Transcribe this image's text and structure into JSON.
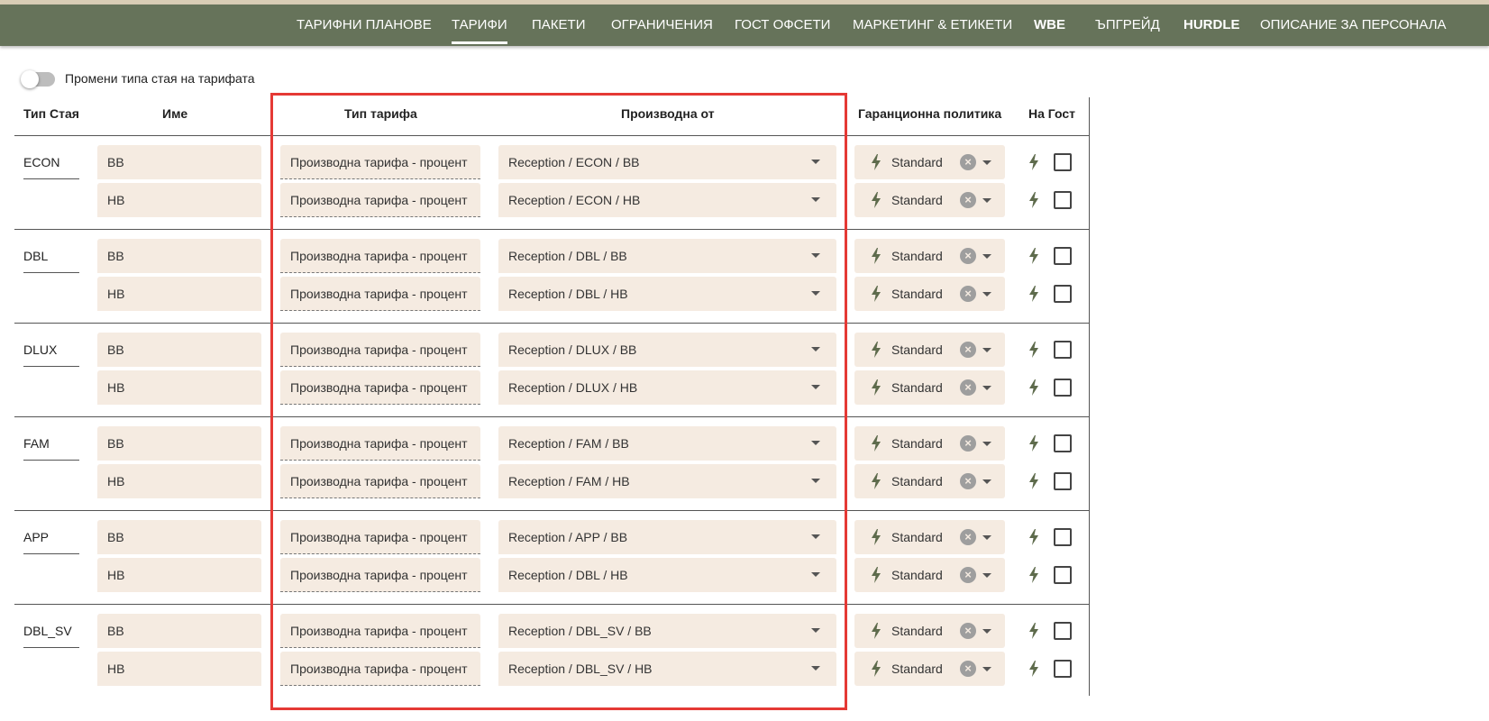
{
  "nav": {
    "items": [
      {
        "label": "ТАРИФНИ ПЛАНОВЕ",
        "bold": false,
        "active": false
      },
      {
        "label": "ТАРИФИ",
        "bold": false,
        "active": true
      },
      {
        "label": "ПАКЕТИ",
        "bold": false,
        "active": false
      },
      {
        "label": "ОГРАНИЧЕНИЯ",
        "bold": false,
        "active": false
      },
      {
        "label": "ГОСТ ОФСЕТИ",
        "bold": false,
        "active": false
      },
      {
        "label": "МАРКЕТИНГ & ЕТИКЕТИ",
        "bold": false,
        "active": false
      },
      {
        "label": "WBE",
        "bold": true,
        "active": false
      },
      {
        "label": "ЪПГРЕЙД",
        "bold": false,
        "active": false
      },
      {
        "label": "HURDLE",
        "bold": true,
        "active": false
      },
      {
        "label": "ОПИСАНИЕ ЗА ПЕРСОНАЛА",
        "bold": false,
        "active": false
      }
    ]
  },
  "toggle": {
    "label": "Промени типа стая на тарифата",
    "on": false
  },
  "headers": {
    "room_type": "Тип Стая",
    "name": "Име",
    "rate_type": "Тип тарифа",
    "derived_from": "Производна от",
    "guarantee": "Гаранционна политика",
    "on_guest": "На Гост"
  },
  "rooms": [
    {
      "code": "ECON",
      "rates": [
        {
          "name": "BB",
          "type": "Производна тарифа - процент",
          "derived": "Reception / ECON / BB",
          "policy": "Standard",
          "guest_checked": false
        },
        {
          "name": "HB",
          "type": "Производна тарифа - процент",
          "derived": "Reception / ECON / HB",
          "policy": "Standard",
          "guest_checked": false
        }
      ]
    },
    {
      "code": "DBL",
      "rates": [
        {
          "name": "BB",
          "type": "Производна тарифа - процент",
          "derived": "Reception / DBL / BB",
          "policy": "Standard",
          "guest_checked": false
        },
        {
          "name": "HB",
          "type": "Производна тарифа - процент",
          "derived": "Reception / DBL / HB",
          "policy": "Standard",
          "guest_checked": false
        }
      ]
    },
    {
      "code": "DLUX",
      "rates": [
        {
          "name": "BB",
          "type": "Производна тарифа - процент",
          "derived": "Reception / DLUX / BB",
          "policy": "Standard",
          "guest_checked": false
        },
        {
          "name": "HB",
          "type": "Производна тарифа - процент",
          "derived": "Reception / DLUX / HB",
          "policy": "Standard",
          "guest_checked": false
        }
      ]
    },
    {
      "code": "FAM",
      "rates": [
        {
          "name": "BB",
          "type": "Производна тарифа - процент",
          "derived": "Reception / FAM / BB",
          "policy": "Standard",
          "guest_checked": false
        },
        {
          "name": "HB",
          "type": "Производна тарифа - процент",
          "derived": "Reception / FAM / HB",
          "policy": "Standard",
          "guest_checked": false
        }
      ]
    },
    {
      "code": "APP",
      "rates": [
        {
          "name": "BB",
          "type": "Производна тарифа - процент",
          "derived": "Reception / APP / BB",
          "policy": "Standard",
          "guest_checked": false
        },
        {
          "name": "HB",
          "type": "Производна тарифа - процент",
          "derived": "Reception / DBL / HB",
          "policy": "Standard",
          "guest_checked": false
        }
      ]
    },
    {
      "code": "DBL_SV",
      "rates": [
        {
          "name": "BB",
          "type": "Производна тарифа - процент",
          "derived": "Reception / DBL_SV / BB",
          "policy": "Standard",
          "guest_checked": false
        },
        {
          "name": "HB",
          "type": "Производна тарифа - процент",
          "derived": "Reception / DBL_SV / HB",
          "policy": "Standard",
          "guest_checked": false
        }
      ]
    }
  ],
  "icons": {
    "quick": "bolt-icon",
    "clear": "clear-icon",
    "dropdown": "chevron-down-icon"
  },
  "colors": {
    "nav_bg": "#66735a",
    "field_bg": "#f5ebe1",
    "highlight": "#e53935",
    "bolt": "#5e6b4c"
  }
}
